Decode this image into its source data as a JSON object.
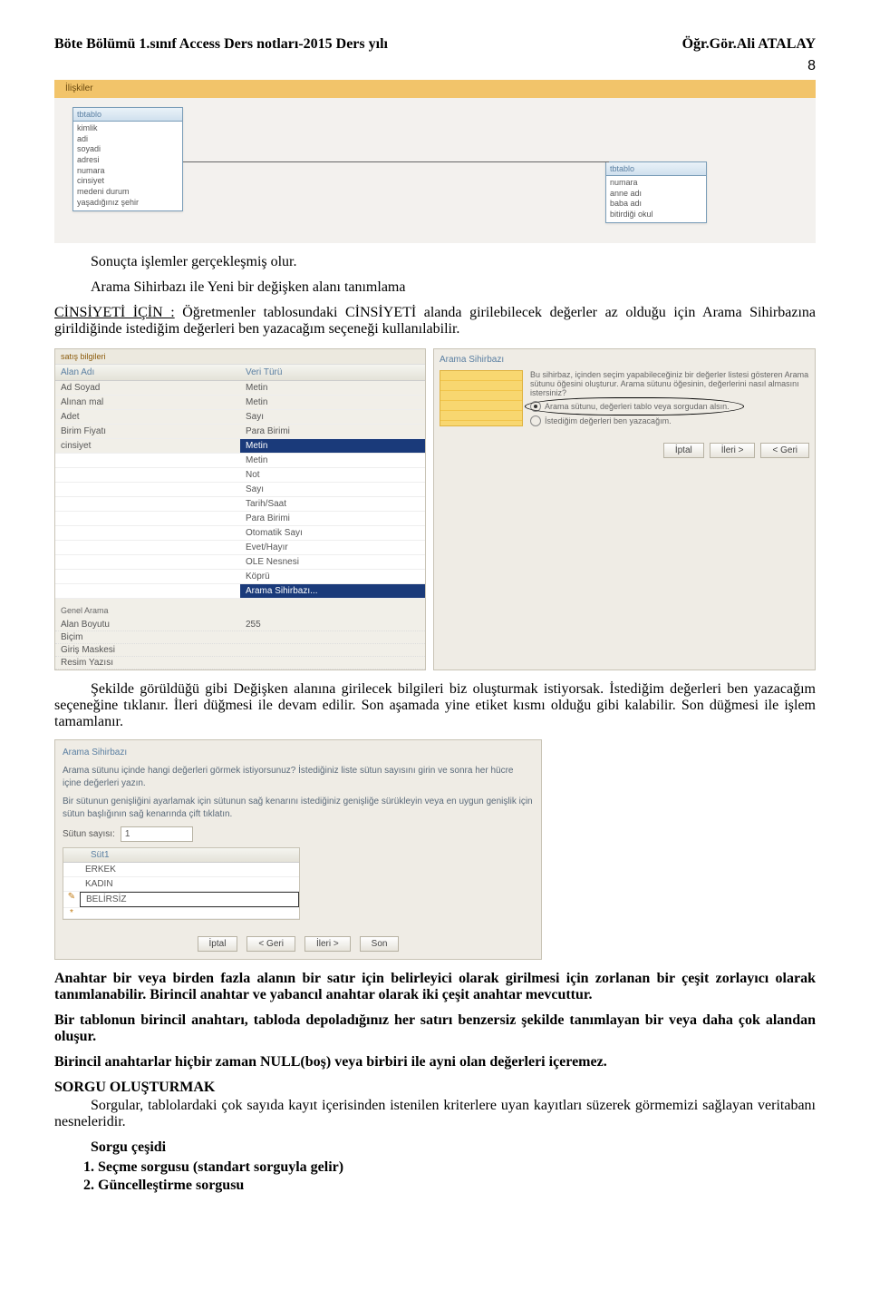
{
  "header": {
    "left": "Böte Bölümü 1.sınıf Access Ders notları-2015 Ders yılı",
    "right": "Öğr.Gör.Ali ATALAY",
    "pageNumber": "8"
  },
  "figure1": {
    "tab": "İlişkiler",
    "leftBox": {
      "title": "tbtablo",
      "fields": [
        "kimlik",
        "adi",
        "soyadi",
        "adresi",
        "numara",
        "cinsiyet",
        "medeni durum",
        "yaşadığınız şehir"
      ]
    },
    "rightBox": {
      "title": "tbtablo",
      "fields": [
        "numara",
        "anne adı",
        "baba adı",
        "bitirdiği okul"
      ]
    }
  },
  "text": {
    "p1": "Sonuçta işlemler gerçekleşmiş olur.",
    "p2": "Arama Sihirbazı ile Yeni bir değişken alanı tanımlama",
    "p3a": "CİNSİYETİ İÇİN  :",
    "p3b": " Öğretmenler tablosundaki CİNSİYETİ alanda girilebilecek değerler az olduğu için Arama Sihirbazına girildiğinde istediğim değerleri ben yazacağım seçeneği kullanılabilir.",
    "p4": "Şekilde görüldüğü gibi Değişken alanına girilecek bilgileri biz oluşturmak istiyorsak. İstediğim değerleri ben yazacağım seçeneğine tıklanır. İleri düğmesi ile devam edilir. Son aşamada yine etiket kısmı olduğu gibi kalabilir. Son düğmesi ile işlem tamamlanır.",
    "p5": "Anahtar bir veya birden fazla alanın bir satır için belirleyici olarak girilmesi için zorlanan bir çeşit zorlayıcı olarak tanımlanabilir. Birincil anahtar ve yabancıl anahtar olarak iki çeşit anahtar mevcuttur.",
    "p6": "Bir tablonun birincil anahtarı, tabloda depoladığınız her satırı benzersiz şekilde tanımlayan bir veya daha çok alandan oluşur.",
    "p7": "Birincil anahtarlar hiçbir zaman NULL(boş) veya birbiri ile ayni olan değerleri içeremez.",
    "h1": "SORGU OLUŞTURMAK",
    "p8": "Sorgular, tablolardaki çok sayıda kayıt içerisinden istenilen kriterlere uyan kayıtları süzerek görmemizi sağlayan veritabanı nesneleridir.",
    "h2": "Sorgu  çeşidi",
    "li1": "Seçme sorgusu (standart sorguyla gelir)",
    "li2": "Güncelleştirme sorgusu"
  },
  "figure2": {
    "tab": "satış bilgileri",
    "col1": "Alan Adı",
    "col2": "Veri Türü",
    "rows": [
      {
        "a": "Ad Soyad",
        "v": "Metin"
      },
      {
        "a": "Alınan mal",
        "v": "Metin"
      },
      {
        "a": "Adet",
        "v": "Sayı"
      },
      {
        "a": "Birim Fiyatı",
        "v": "Para Birimi"
      },
      {
        "a": "cinsiyet",
        "v": "Metin",
        "sel": true
      }
    ],
    "dropdown": [
      "Metin",
      "Not",
      "Sayı",
      "Tarih/Saat",
      "Para Birimi",
      "Otomatik Sayı",
      "Evet/Hayır",
      "OLE Nesnesi",
      "Köprü",
      "Arama Sihirbazı..."
    ],
    "generalTab": "Genel   Arama",
    "props": [
      {
        "a": "Alan Boyutu",
        "v": "255"
      },
      {
        "a": "Biçim",
        "v": ""
      },
      {
        "a": "Giriş Maskesi",
        "v": ""
      },
      {
        "a": "Resim Yazısı",
        "v": ""
      }
    ]
  },
  "wizard1": {
    "title": "Arama Sihirbazı",
    "intro": "Bu sihirbaz, içinden seçim yapabileceğiniz bir değerler listesi gösteren Arama sütunu öğesini oluşturur.  Arama sütunu öğesinin, değerlerini nasıl almasını istersiniz?",
    "opt1": "Arama sütunu, değerleri tablo veya sorgudan alsın.",
    "opt2": "İstediğim değerleri ben yazacağım.",
    "btn_cancel": "İptal",
    "btn_next": "İleri >",
    "btn_back": "< Geri"
  },
  "wizard2": {
    "title": "Arama Sihirbazı",
    "desc1": "Arama sütunu içinde hangi değerleri görmek istiyorsunuz? İstediğiniz liste sütun sayısını girin ve sonra her hücre içine değerleri yazın.",
    "desc2": "Bir sütunun genişliğini ayarlamak için sütunun sağ kenarını istediğiniz genişliğe sürükleyin veya en uygun genişlik için sütun başlığının sağ kenarında çift tıklatın.",
    "countLabel": "Sütun sayısı:",
    "countValue": "1",
    "colHeader": "Süt1",
    "rows": [
      "ERKEK",
      "KADIN",
      "BELİRSİZ"
    ],
    "buttons": {
      "cancel": "İptal",
      "back": "< Geri",
      "next": "İleri >",
      "finish": "Son"
    }
  }
}
